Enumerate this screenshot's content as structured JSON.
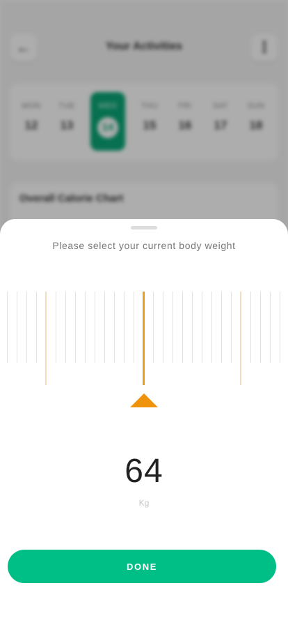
{
  "background": {
    "header": {
      "title": "Your Activities",
      "back_icon": "←",
      "menu_icon": "⋮"
    },
    "week": [
      {
        "day": "MON",
        "date": "12"
      },
      {
        "day": "TUE",
        "date": "13"
      },
      {
        "day": "WED",
        "date": "14",
        "selected": true
      },
      {
        "day": "THU",
        "date": "15"
      },
      {
        "day": "FRI",
        "date": "16"
      },
      {
        "day": "SAT",
        "date": "17"
      },
      {
        "day": "SUN",
        "date": "18"
      }
    ],
    "chart_card": {
      "title": "Overall Calorie Chart"
    }
  },
  "sheet": {
    "prompt": "Please select your current body weight",
    "weight": {
      "value": "64",
      "unit": "Kg"
    },
    "done_label": "DONE"
  },
  "colors": {
    "accent_green": "#00bf86",
    "ruler_pointer": "#f0930c",
    "ruler_center": "#e8a012"
  }
}
